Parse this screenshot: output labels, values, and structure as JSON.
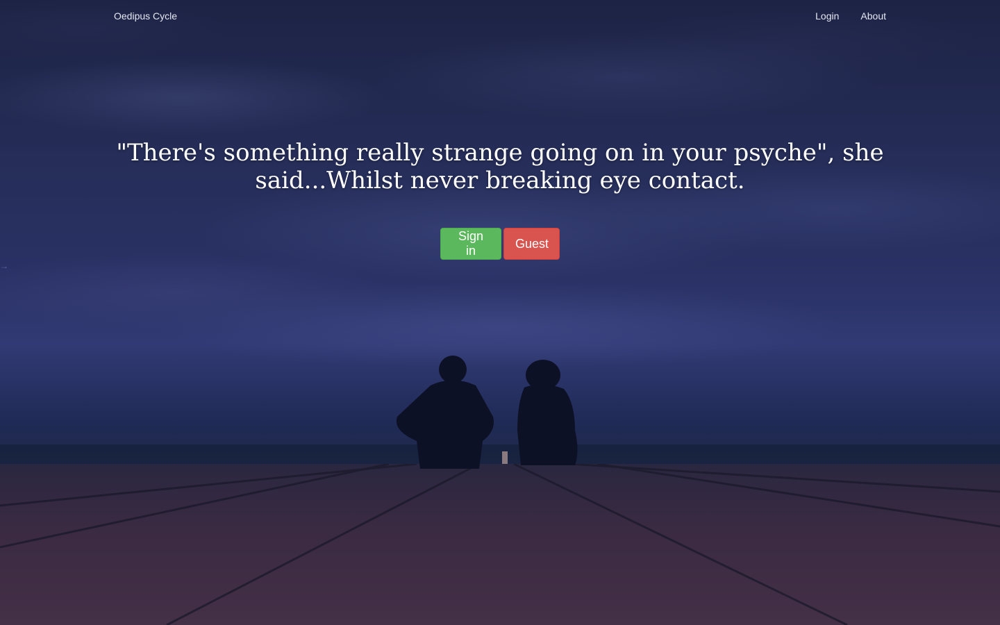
{
  "navbar": {
    "brand": "Oedipus Cycle",
    "links": [
      {
        "label": "Login"
      },
      {
        "label": "About"
      }
    ]
  },
  "hero": {
    "quote": "\"There's something really strange going on in your psyche\", she said...Whilst never breaking eye contact."
  },
  "actions": {
    "signin_label": "Sign in",
    "guest_label": "Guest"
  },
  "colors": {
    "success": "#5cb85c",
    "danger": "#d9534f",
    "sky": "#252d58",
    "pier": "#3a2a42"
  },
  "icons": {
    "side_arrow": "arrow-right-icon"
  }
}
